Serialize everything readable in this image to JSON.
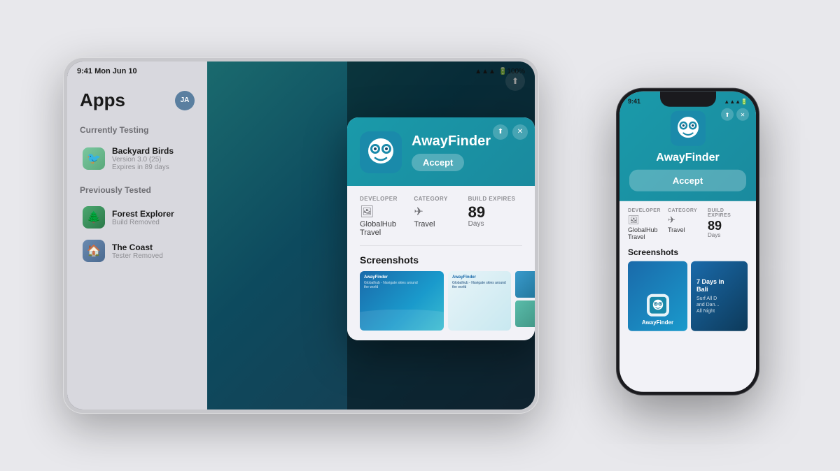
{
  "page": {
    "background_color": "#e8e8ec"
  },
  "tablet": {
    "status_time": "9:41  Mon Jun 10",
    "status_icons": "▲▲▲ 100%",
    "share_icon": "⬆",
    "build_expires_label": "BUILD EXPIRES",
    "build_days": "89",
    "build_days_label": "Days"
  },
  "sidebar": {
    "title": "Apps",
    "avatar_initials": "JA",
    "currently_testing_label": "Currently Testing",
    "previously_tested_label": "Previously Tested",
    "apps_currently": [
      {
        "name": "Backyard Birds",
        "version": "Version 3.0 (25)",
        "expires": "Expires in 89 days",
        "icon_color": "#7ac8a0"
      }
    ],
    "apps_previously": [
      {
        "name": "Forest Explorer",
        "status": "Build Removed",
        "icon_color": "#4ca870"
      },
      {
        "name": "The Coast",
        "status": "Tester Removed",
        "icon_color": "#6a8ab0"
      }
    ]
  },
  "modal": {
    "share_icon": "⬆",
    "close_icon": "✕",
    "app_name": "AwayFinder",
    "accept_label": "Accept",
    "developer_label": "DEVELOPER",
    "developer_icon": "🖼",
    "developer_value": "GlobalHub Travel",
    "category_label": "CATEGORY",
    "category_icon": "✈",
    "category_value": "Travel",
    "build_expires_label": "BUILD EXPIRES",
    "build_days": "89",
    "build_days_unit": "Days",
    "screenshots_title": "Screenshots"
  },
  "phone": {
    "status_time": "9:41",
    "status_icons": "▲▲▲",
    "share_icon": "⬆",
    "close_icon": "✕",
    "app_name": "AwayFinder",
    "accept_label": "Accept",
    "developer_label": "DEVELOPER",
    "developer_icon": "🖼",
    "developer_value": "GlobalHub Travel",
    "category_label": "CATEGORY",
    "category_icon": "✈",
    "category_value": "Travel",
    "build_expires_label": "BUILD EXPIRES",
    "build_days": "89",
    "build_days_unit": "Days",
    "screenshots_title": "Screenshots",
    "screenshot1_brand": "AwayFinder",
    "screenshot2_line1": "7 Days in",
    "screenshot2_line2": "Bali",
    "screenshot2_sub1": "Surf All D",
    "screenshot2_sub2": "and Dan...",
    "screenshot2_sub3": "All Night"
  }
}
